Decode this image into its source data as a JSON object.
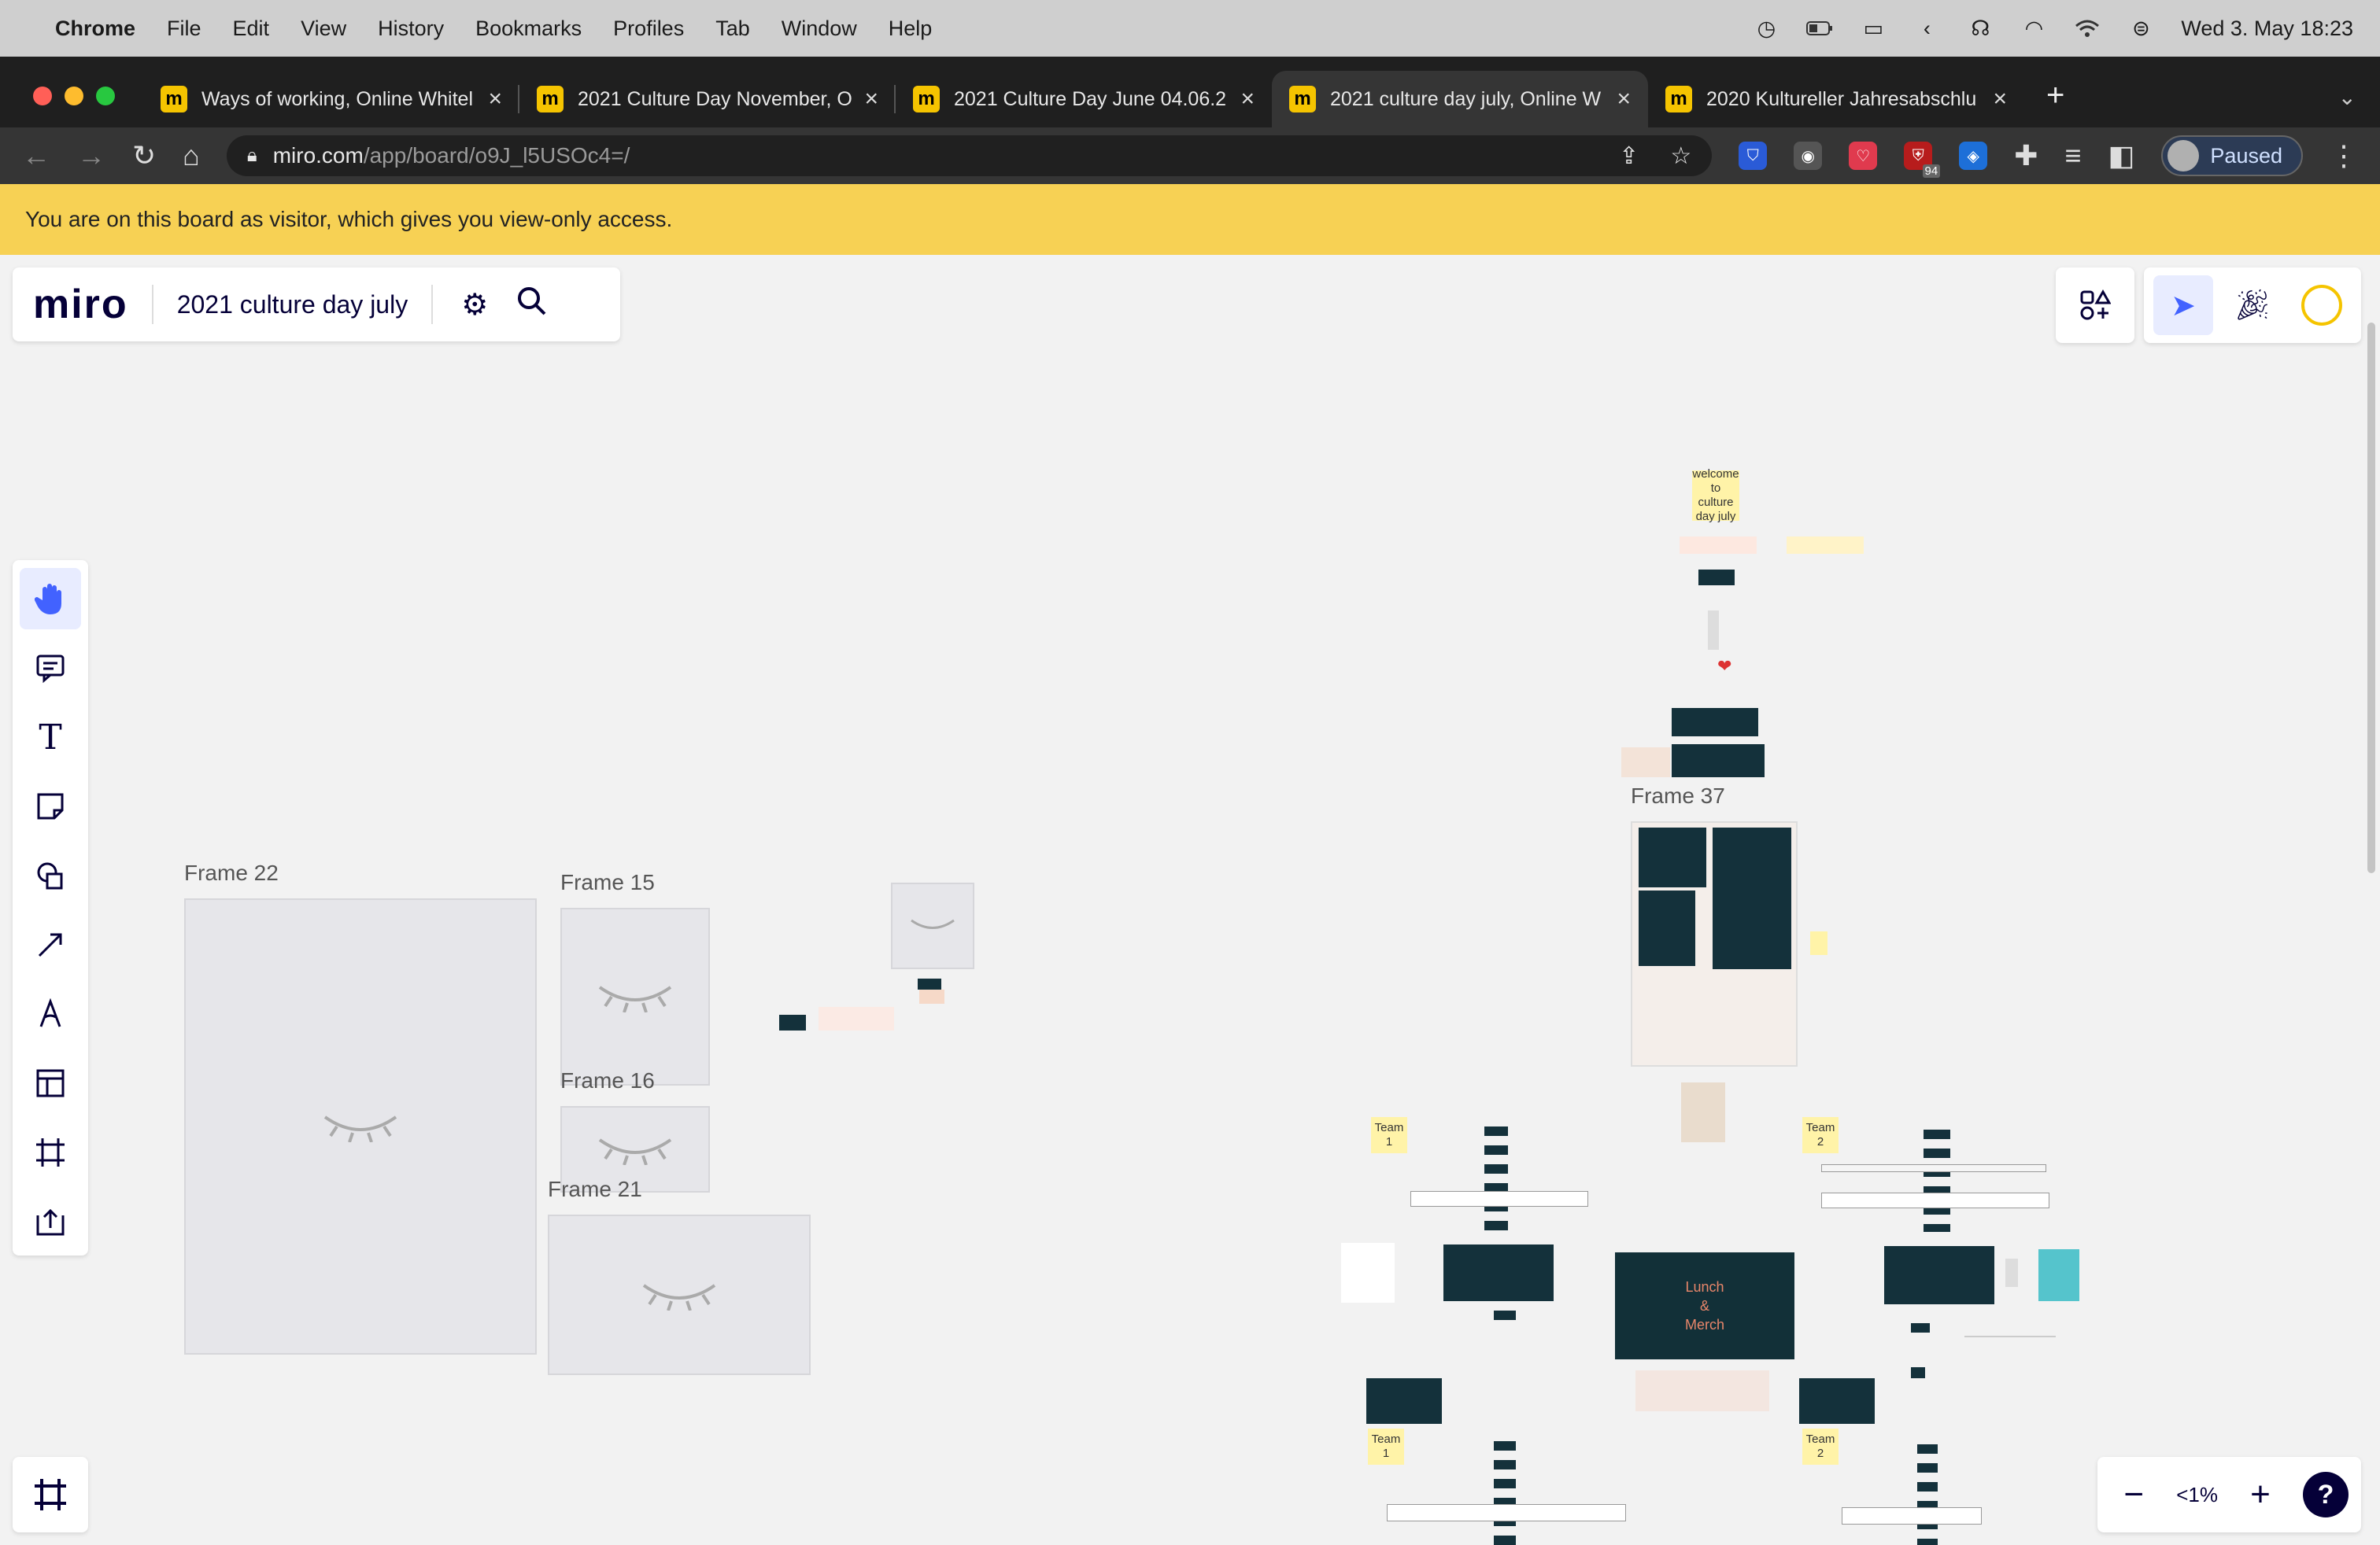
{
  "menubar": {
    "app": "Chrome",
    "items": [
      "File",
      "Edit",
      "View",
      "History",
      "Bookmarks",
      "Profiles",
      "Tab",
      "Window",
      "Help"
    ],
    "datetime": "Wed 3. May  18:23"
  },
  "tabs": [
    {
      "title": "Ways of working, Online Whitel"
    },
    {
      "title": "2021 Culture Day November, O"
    },
    {
      "title": "2021 Culture Day June 04.06.2"
    },
    {
      "title": "2021 culture day july, Online W"
    },
    {
      "title": "2020 Kultureller Jahresabschlu"
    }
  ],
  "address": {
    "host": "miro.com",
    "path": "/app/board/o9J_l5USOc4=/"
  },
  "extensions": {
    "badge": "94"
  },
  "profile": {
    "status": "Paused"
  },
  "banner": {
    "text": "You are on this board as visitor, which gives you view-only access."
  },
  "board": {
    "logo": "miro",
    "title": "2021 culture day july",
    "zoom": "<1%",
    "help": "?"
  },
  "frames": {
    "f22": "Frame 22",
    "f15": "Frame 15",
    "f16": "Frame 16",
    "f21": "Frame 21",
    "f37": "Frame 37"
  },
  "stickies": {
    "welcome": "welcome to culture day july",
    "team1a": "Team 1",
    "team2a": "Team 2",
    "team1b": "Team 1",
    "team2b": "Team 2"
  },
  "lunch": {
    "l1": "Lunch",
    "l2": "&",
    "l3": "Merch"
  },
  "colors": {
    "banner": "#f7d154",
    "accent": "#4262ff",
    "miro_navy": "#050038",
    "dark_card": "#14313b"
  }
}
